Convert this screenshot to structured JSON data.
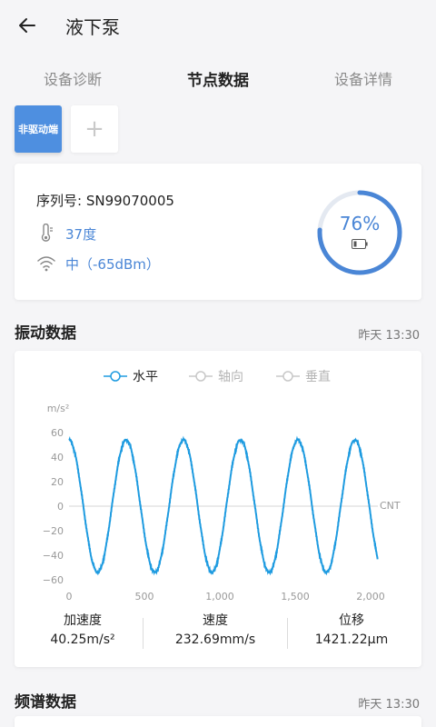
{
  "header": {
    "title": "液下泵"
  },
  "tabs": [
    {
      "label": "设备诊断"
    },
    {
      "label": "节点数据"
    },
    {
      "label": "设备详情"
    }
  ],
  "nodes": {
    "active_label": "非驱动端",
    "add_label": "+"
  },
  "device": {
    "serial": "序列号: SN99070005",
    "temperature": "37度",
    "signal": "中（-65dBm）",
    "battery_percent": "76%",
    "battery_level": 0.76
  },
  "vibration": {
    "title": "振动数据",
    "time": "昨天 13:30",
    "legend": [
      "水平",
      "轴向",
      "垂直"
    ],
    "stats": [
      {
        "label": "加速度",
        "value": "40.25m/s²"
      },
      {
        "label": "速度",
        "value": "232.69mm/s"
      },
      {
        "label": "位移",
        "value": "1421.22μm"
      }
    ]
  },
  "spectrum": {
    "title": "频谱数据",
    "time": "昨天 13:30"
  },
  "colors": {
    "accent": "#4a86d6",
    "series": "#1e9be0",
    "inactive": "#c8c8c8"
  },
  "chart_data": {
    "type": "line",
    "ylabel": "m/s²",
    "xlabel": "CNT",
    "xlim": [
      0,
      2048
    ],
    "ylim": [
      -60,
      60
    ],
    "xticks": [
      0,
      500,
      1000,
      1500,
      2000
    ],
    "xtick_labels": [
      "0",
      "500",
      "1,000",
      "1,500",
      "2,000"
    ],
    "yticks": [
      60,
      40,
      20,
      0,
      -20,
      -40,
      -60
    ],
    "ytick_labels": [
      "60",
      "40",
      "20",
      "0",
      "−20",
      "−40",
      "−60"
    ],
    "grid": false,
    "legend_placement": "top-center",
    "series": [
      {
        "name": "水平",
        "amplitude": 54,
        "cycles": 5.4,
        "phase_deg": 90,
        "points": 2048,
        "visible": true
      },
      {
        "name": "轴向",
        "visible": false
      },
      {
        "name": "垂直",
        "visible": false
      }
    ]
  }
}
